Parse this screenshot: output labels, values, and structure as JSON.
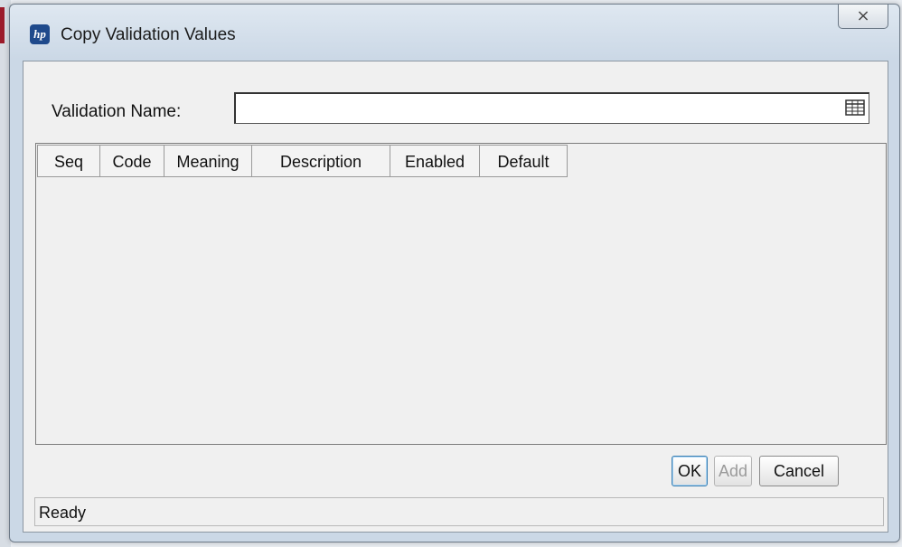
{
  "window": {
    "title": "Copy Validation Values",
    "close_glyph": "⨯",
    "logo_text": "hp"
  },
  "form": {
    "validation_name_label": "Validation Name:",
    "validation_name_value": "",
    "lookup_icon": "list-lookup-icon"
  },
  "table": {
    "columns": [
      "Seq",
      "Code",
      "Meaning",
      "Description",
      "Enabled",
      "Default"
    ],
    "rows": []
  },
  "buttons": {
    "ok": "OK",
    "add": "Add",
    "cancel": "Cancel"
  },
  "status": {
    "text": "Ready"
  },
  "colors": {
    "accent": "#3c7fb1",
    "disabled_text": "#9a9a9a"
  }
}
